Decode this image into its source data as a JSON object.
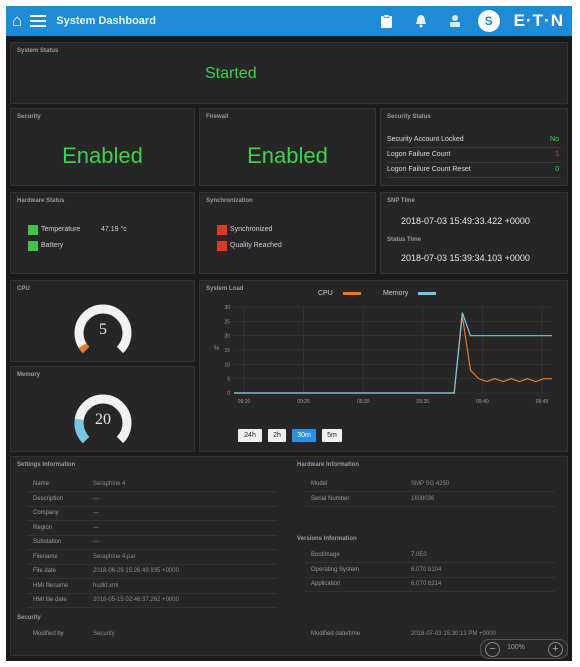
{
  "topbar": {
    "title": "System Dashboard",
    "user_initial": "S",
    "logo": "E·T·N",
    "color": "#1f8bd6"
  },
  "system_status": {
    "title": "System Status",
    "value": "Started"
  },
  "security": {
    "title": "Security",
    "value": "Enabled"
  },
  "firewall": {
    "title": "Firewall",
    "value": "Enabled"
  },
  "security_status": {
    "title": "Security Status",
    "rows": [
      {
        "label": "Security Account Locked",
        "value": "No",
        "color": "#3fd24a"
      },
      {
        "label": "Logon Failure Count",
        "value": "1",
        "color": "#d93a2b"
      },
      {
        "label": "Logon Failure Count Reset",
        "value": "0",
        "color": "#3fd24a"
      }
    ]
  },
  "hardware_status": {
    "title": "Hardware Status",
    "temperature_label": "Temperature",
    "temperature_value": "47.19 °c",
    "battery_label": "Battery"
  },
  "synchronization": {
    "title": "Synchronization",
    "items": [
      "Synchronized",
      "Quality Reached"
    ]
  },
  "time": {
    "snmp_title": "SNP Time",
    "snmp_value": "2018-07-03 15:49:33.422 +0000",
    "status_title": "Status Time",
    "status_value": "2018-07-03 15:39:34.103 +0000"
  },
  "cpu": {
    "title": "CPU",
    "value": "5",
    "percent": 5
  },
  "memory": {
    "title": "Memory",
    "value": "20",
    "percent": 20
  },
  "system_load": {
    "title": "System Load",
    "legend_cpu": "CPU",
    "legend_memory": "Memory",
    "timeframes": [
      "24h",
      "2h",
      "30m",
      "5m"
    ],
    "active_timeframe": "30m"
  },
  "chart_data": {
    "type": "line",
    "title": "System Load",
    "ylabel": "%",
    "ylim": [
      0,
      30
    ],
    "y_ticks": [
      "30",
      "25",
      "20",
      "15",
      "10",
      "5",
      "0"
    ],
    "x_ticks": [
      "09:20",
      "09:25",
      "09:30",
      "09:35",
      "09:40",
      "09:45"
    ],
    "series": [
      {
        "name": "CPU",
        "color": "#e8792d",
        "values": [
          0,
          0,
          0,
          0,
          0,
          0,
          0,
          0,
          0,
          0,
          0,
          0,
          0,
          0,
          0,
          0,
          0,
          0,
          0,
          0,
          0,
          0,
          0,
          0,
          0,
          0,
          0,
          0,
          27,
          8,
          5,
          4,
          5,
          4,
          5,
          4,
          5,
          4,
          5,
          5
        ]
      },
      {
        "name": "Memory",
        "color": "#74c9e0",
        "values": [
          0,
          0,
          0,
          0,
          0,
          0,
          0,
          0,
          0,
          0,
          0,
          0,
          0,
          0,
          0,
          0,
          0,
          0,
          0,
          0,
          0,
          0,
          0,
          0,
          0,
          0,
          0,
          0,
          28,
          20,
          20,
          20,
          20,
          20,
          20,
          20,
          20,
          20,
          20,
          20
        ]
      }
    ]
  },
  "settings_info": {
    "title": "Settings Information",
    "rows": [
      {
        "label": "Name",
        "value": "Seraphine 4"
      },
      {
        "label": "Description",
        "value": "---"
      },
      {
        "label": "Company",
        "value": "---"
      },
      {
        "label": "Region",
        "value": "---"
      },
      {
        "label": "Substation",
        "value": "---"
      },
      {
        "label": "Filename",
        "value": "Seraphine 4.par"
      },
      {
        "label": "File date",
        "value": "2018-06-29 15:26:49.935 +0000"
      },
      {
        "label": "HMI filename",
        "value": "hsdkt.xml"
      },
      {
        "label": "HMI file date",
        "value": "2018-05-15 02:46:37.262 +0000"
      }
    ]
  },
  "hardware_info": {
    "title": "Hardware Information",
    "rows": [
      {
        "label": "Model",
        "value": "SMP SG 4250"
      },
      {
        "label": "Serial Number",
        "value": "1608036"
      }
    ]
  },
  "versions_info": {
    "title": "Versions Information",
    "rows": [
      {
        "label": "Bootimage",
        "value": "7.0E0"
      },
      {
        "label": "Operating System",
        "value": "6.0T0 b104"
      },
      {
        "label": "Application",
        "value": "6.0T0 b214"
      }
    ]
  },
  "security_footer": {
    "title": "Security",
    "modified_by_label": "Modified by",
    "modified_by_value": "Security",
    "modified_datetime_label": "Modified date/time",
    "modified_datetime_value": "2018-07-03 15:30:13 PM +0000"
  },
  "zoom": {
    "label": "100%"
  }
}
